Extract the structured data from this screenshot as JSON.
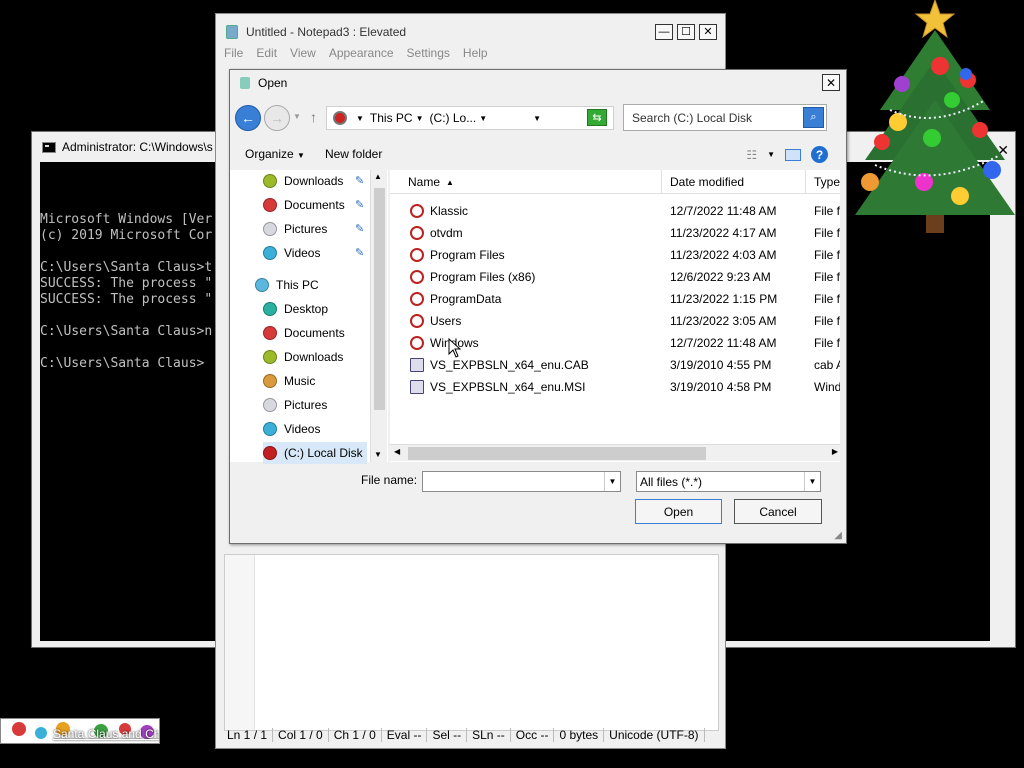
{
  "console": {
    "title": "Administrator: C:\\Windows\\s",
    "lines": [
      "Microsoft Windows [Ver",
      "(c) 2019 Microsoft Cor",
      "",
      "C:\\Users\\Santa Claus>t",
      "SUCCESS: The process \"",
      "SUCCESS: The process \"",
      "",
      "C:\\Users\\Santa Claus>n",
      "",
      "C:\\Users\\Santa Claus>"
    ]
  },
  "notepad": {
    "title": "Untitled - Notepad3 : Elevated",
    "menu": [
      "File",
      "Edit",
      "View",
      "Appearance",
      "Settings",
      "Help"
    ],
    "status": [
      "Ln  1 / 1",
      "Col  1 / 0",
      "Ch  1 / 0",
      "Eval  --",
      "Sel  --",
      "SLn  --",
      "Occ  --",
      "0 bytes",
      "Unicode (UTF-8)"
    ]
  },
  "dialog": {
    "title": "Open",
    "address": {
      "segment1": "This PC",
      "segment2": "(C:) Lo..."
    },
    "search_placeholder": "Search (C:) Local Disk",
    "toolbar": {
      "organize": "Organize",
      "new_folder": "New folder"
    },
    "nav": {
      "quick": [
        {
          "label": "Downloads",
          "color": "#9aba2a"
        },
        {
          "label": "Documents",
          "color": "#d63a3a"
        },
        {
          "label": "Pictures",
          "color": "#d8d8e0"
        },
        {
          "label": "Videos",
          "color": "#3ab0d8"
        }
      ],
      "this_pc": "This PC",
      "pc_items": [
        {
          "label": "Desktop",
          "color": "#2ab0a0"
        },
        {
          "label": "Documents",
          "color": "#d63a3a"
        },
        {
          "label": "Downloads",
          "color": "#9aba2a"
        },
        {
          "label": "Music",
          "color": "#d89a3a"
        },
        {
          "label": "Pictures",
          "color": "#d8d8e0"
        },
        {
          "label": "Videos",
          "color": "#3ab0d8"
        },
        {
          "label": "(C:) Local Disk",
          "color": "#c22020"
        }
      ]
    },
    "columns": {
      "name": "Name",
      "date": "Date modified",
      "type": "Type"
    },
    "files": [
      {
        "name": "Klassic",
        "date": "12/7/2022 11:48 AM",
        "type": "File fo",
        "kind": "folder"
      },
      {
        "name": "otvdm",
        "date": "11/23/2022 4:17 AM",
        "type": "File fo",
        "kind": "folder"
      },
      {
        "name": "Program Files",
        "date": "11/23/2022 4:03 AM",
        "type": "File fo",
        "kind": "folder"
      },
      {
        "name": "Program Files (x86)",
        "date": "12/6/2022 9:23 AM",
        "type": "File fo",
        "kind": "folder"
      },
      {
        "name": "ProgramData",
        "date": "11/23/2022 1:15 PM",
        "type": "File fo",
        "kind": "folder"
      },
      {
        "name": "Users",
        "date": "11/23/2022 3:05 AM",
        "type": "File fo",
        "kind": "folder"
      },
      {
        "name": "Windows",
        "date": "12/7/2022 11:48 AM",
        "type": "File fo",
        "kind": "folder"
      },
      {
        "name": "VS_EXPBSLN_x64_enu.CAB",
        "date": "3/19/2010 4:55 PM",
        "type": "cab A",
        "kind": "file"
      },
      {
        "name": "VS_EXPBSLN_x64_enu.MSI",
        "date": "3/19/2010 4:58 PM",
        "type": "Wind",
        "kind": "file"
      }
    ],
    "file_name_label": "File name:",
    "file_name_value": "",
    "file_type": "All files (*.*)",
    "open_label": "Open",
    "cancel_label": "Cancel"
  },
  "taskbar": {
    "label": "Santa Claus and Ch"
  }
}
